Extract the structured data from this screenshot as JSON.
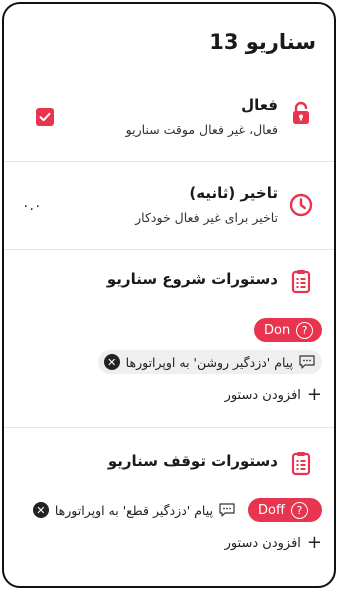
{
  "title": "سناریو 13",
  "active": {
    "title": "فعال",
    "subtitle": "فعال، غیر فعال موقت سناریو",
    "checked": true
  },
  "delay": {
    "title": "تاخیر (ثانیه)",
    "subtitle": "تاخیر برای غیر فعال خودکار",
    "value": "۰.۰"
  },
  "start_commands": {
    "title": "دستورات شروع سناریو",
    "pill_label": "Don",
    "help_glyph": "?",
    "message": "پیام 'دزدگیر روشن' به اوپراتورها",
    "close_glyph": "✕",
    "add_label": "افزودن دستور",
    "plus_glyph": "+"
  },
  "stop_commands": {
    "title": "دستورات توقف سناریو",
    "pill_label": "Doff",
    "help_glyph": "?",
    "message": "پیام 'دزدگیر قطع' به اوپراتورها",
    "close_glyph": "✕",
    "add_label": "افزودن دستور",
    "plus_glyph": "+"
  },
  "colors": {
    "accent": "#e8344e"
  }
}
